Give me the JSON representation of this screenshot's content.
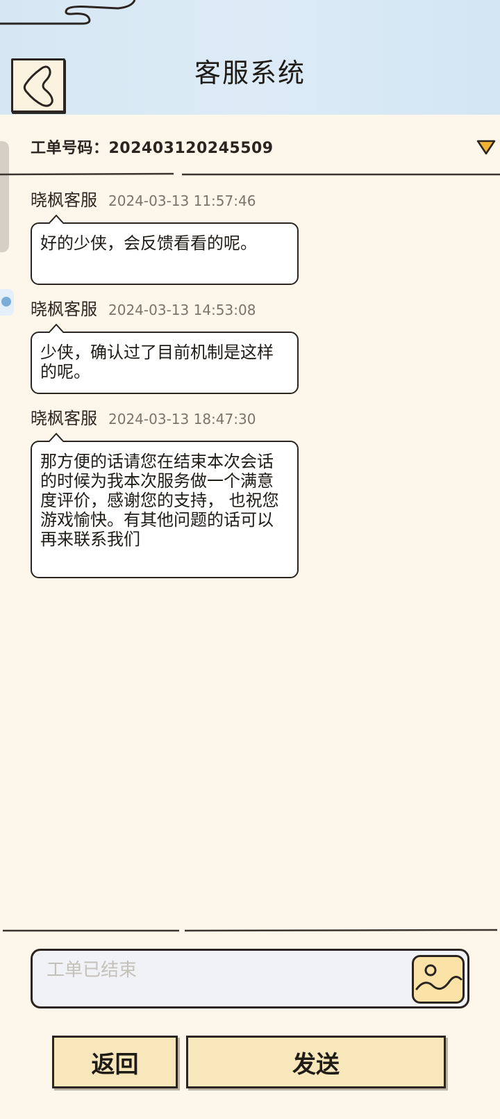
{
  "header": {
    "title": "客服系统",
    "back_icon": "back-arrow-icon"
  },
  "ticket": {
    "label": "工单号码：202403120245509",
    "dropdown_icon": "triangle-down-icon",
    "dropdown_color": "#f2b233"
  },
  "messages": [
    {
      "sender": "晓枫客服",
      "time": "2024-03-13 11:57:46",
      "text": "好的少侠，会反馈看看的呢。"
    },
    {
      "sender": "晓枫客服",
      "time": "2024-03-13 14:53:08",
      "text": "少侠，确认过了目前机制是这样的呢。"
    },
    {
      "sender": "晓枫客服",
      "time": "2024-03-13 18:47:30",
      "text": "那方便的话请您在结束本次会话的时候为我本次服务做一个满意度评价，感谢您的支持， 也祝您游戏愉快。有其他问题的话可以再来联系我们"
    }
  ],
  "composer": {
    "placeholder": "工单已结束",
    "image_icon": "image-icon"
  },
  "buttons": {
    "back_label": "返回",
    "send_label": "发送"
  },
  "colors": {
    "header_bg": "#d6e7f3",
    "page_bg": "#fdf6ea",
    "button_bg": "#f8e7bb",
    "image_button_bg": "#fbe3a8"
  }
}
